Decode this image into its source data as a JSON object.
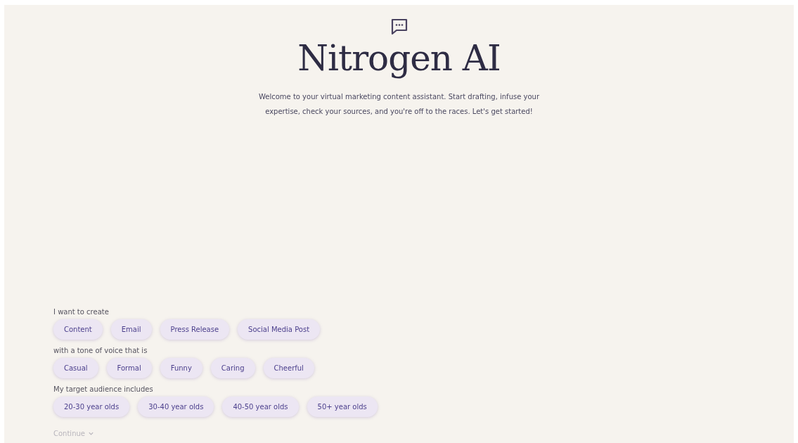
{
  "header": {
    "title": "Nitrogen AI",
    "intro": "Welcome to your virtual marketing content assistant. Start drafting, infuse your expertise, check your sources, and you're off to the races. Let's get started!"
  },
  "groups": [
    {
      "label": "I want to create",
      "options": [
        "Content",
        "Email",
        "Press Release",
        "Social Media Post"
      ]
    },
    {
      "label": "with a tone of voice that is",
      "options": [
        "Casual",
        "Formal",
        "Funny",
        "Caring",
        "Cheerful"
      ]
    },
    {
      "label": "My target audience includes",
      "options": [
        "20-30 year olds",
        "30-40 year olds",
        "40-50 year olds",
        "50+ year olds"
      ]
    }
  ],
  "continue": {
    "label": "Continue",
    "disabled": true
  }
}
